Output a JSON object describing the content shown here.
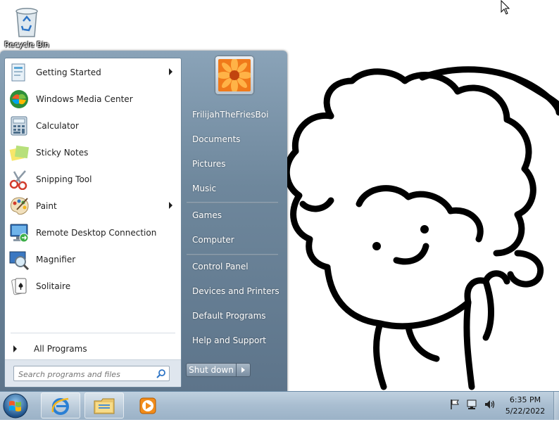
{
  "desktop": {
    "recycle_bin_label": "Recycle Bin"
  },
  "start_menu": {
    "programs": [
      {
        "label": "Getting Started",
        "icon": "getting-started-icon",
        "submenu": true
      },
      {
        "label": "Windows Media Center",
        "icon": "media-center-icon",
        "submenu": false
      },
      {
        "label": "Calculator",
        "icon": "calculator-icon",
        "submenu": false
      },
      {
        "label": "Sticky Notes",
        "icon": "sticky-notes-icon",
        "submenu": false
      },
      {
        "label": "Snipping Tool",
        "icon": "scissors-icon",
        "submenu": false
      },
      {
        "label": "Paint",
        "icon": "paint-palette-icon",
        "submenu": true
      },
      {
        "label": "Remote Desktop Connection",
        "icon": "remote-desktop-icon",
        "submenu": false
      },
      {
        "label": "Magnifier",
        "icon": "magnifier-icon",
        "submenu": false
      },
      {
        "label": "Solitaire",
        "icon": "cards-icon",
        "submenu": false
      }
    ],
    "all_programs_label": "All Programs",
    "search_placeholder": "Search programs and files",
    "user_name": "FrilijahTheFriesBoi",
    "right_links": [
      "Documents",
      "Pictures",
      "Music",
      "Games",
      "Computer",
      "Control Panel",
      "Devices and Printers",
      "Default Programs",
      "Help and Support"
    ],
    "shutdown_label": "Shut down"
  },
  "taskbar": {
    "pinned": [
      "internet-explorer-icon",
      "file-explorer-icon",
      "media-player-icon"
    ],
    "tray_icons": [
      "flag-icon",
      "network-icon",
      "volume-icon"
    ],
    "time": "6:35 PM",
    "date": "5/22/2022"
  },
  "colors": {
    "menu_right_pane": "#6e879c",
    "taskbar": "#a8bdd0"
  }
}
